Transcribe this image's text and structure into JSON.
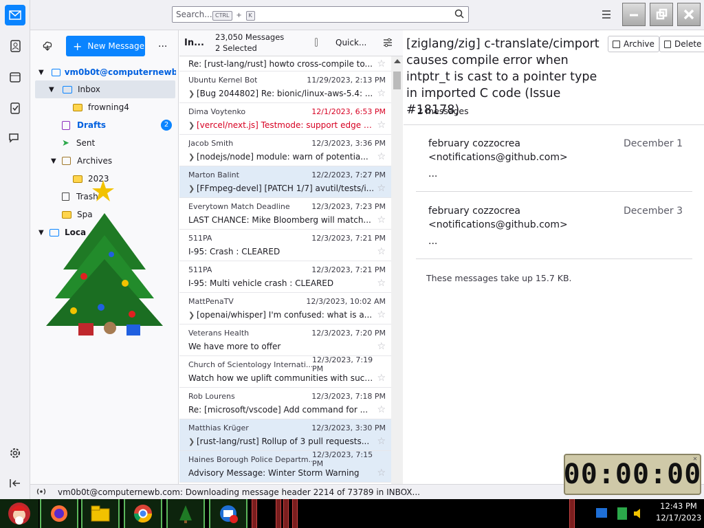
{
  "search": {
    "placeholder": "Search...",
    "shortcut_key1": "CTRL",
    "shortcut_plus": "+",
    "shortcut_key2": "K"
  },
  "folders": {
    "new_message": "New Message",
    "more": "...",
    "account": "vm0b0t@computernewb...",
    "items": [
      {
        "label": "Inbox",
        "icon": "inbox-icon"
      },
      {
        "label": "frowning4",
        "icon": "folder-icon"
      },
      {
        "label": "Drafts",
        "icon": "drafts-icon",
        "badge": "2"
      },
      {
        "label": "Sent",
        "icon": "sent-icon"
      },
      {
        "label": "Archives",
        "icon": "archive-icon"
      },
      {
        "label": "2023",
        "icon": "folder-icon"
      },
      {
        "label": "Trash",
        "icon": "trash-icon"
      },
      {
        "label": "Spa",
        "icon": "folder-icon"
      },
      {
        "label": "Loca",
        "icon": "local-folder-icon"
      }
    ]
  },
  "list": {
    "folder_label": "In...",
    "count": "23,050 Messages",
    "selected": "2 Selected",
    "quick_filter": "Quick...",
    "rows": [
      {
        "sender": "",
        "date": "",
        "subject": "Re: [rust-lang/rust] howto cross-compile to...",
        "thread": false,
        "selected": false,
        "red": false
      },
      {
        "sender": "Ubuntu Kernel Bot",
        "date": "11/29/2023, 2:13 PM",
        "subject": "[Bug 2044802] Re: bionic/linux-aws-5.4: ...",
        "thread": true,
        "selected": false,
        "red": false
      },
      {
        "sender": "Dima Voytenko",
        "date": "12/1/2023, 6:53 PM",
        "subject": "[vercel/next.js] Testmode: support edge fu...",
        "thread": true,
        "selected": false,
        "red": true
      },
      {
        "sender": "Jacob Smith",
        "date": "12/3/2023, 3:36 PM",
        "subject": "[nodejs/node] module: warn of potentia...",
        "thread": true,
        "selected": false,
        "red": false
      },
      {
        "sender": "Marton Balint",
        "date": "12/2/2023, 7:27 PM",
        "subject": "[FFmpeg-devel] [PATCH 1/7] avutil/tests/i...",
        "thread": true,
        "selected": true,
        "red": false
      },
      {
        "sender": "Everytown Match Deadline",
        "date": "12/3/2023, 7:23 PM",
        "subject": "LAST CHANCE: Mike Bloomberg will match...",
        "thread": false,
        "selected": false,
        "red": false
      },
      {
        "sender": "511PA",
        "date": "12/3/2023, 7:21 PM",
        "subject": "I-95: Crash : CLEARED",
        "thread": false,
        "selected": false,
        "red": false
      },
      {
        "sender": "511PA",
        "date": "12/3/2023, 7:21 PM",
        "subject": "I-95: Multi vehicle crash : CLEARED",
        "thread": false,
        "selected": false,
        "red": false
      },
      {
        "sender": "MattPenaTV",
        "date": "12/3/2023, 10:02 AM",
        "subject": "[openai/whisper] I'm confused: what is a...",
        "thread": true,
        "selected": false,
        "red": false
      },
      {
        "sender": "Veterans Health",
        "date": "12/3/2023, 7:20 PM",
        "subject": "We have more to offer",
        "thread": false,
        "selected": false,
        "red": false
      },
      {
        "sender": "Church of Scientology Internati...",
        "date": "12/3/2023, 7:19 PM",
        "subject": "Watch how we uplift communities with succ...",
        "thread": false,
        "selected": false,
        "red": false
      },
      {
        "sender": "Rob Lourens",
        "date": "12/3/2023, 7:18 PM",
        "subject": "Re: [microsoft/vscode] Add command for ...",
        "thread": false,
        "selected": false,
        "red": false
      },
      {
        "sender": "Matthias Krüger",
        "date": "12/3/2023, 3:30 PM",
        "subject": "[rust-lang/rust] Rollup of 3 pull requests...",
        "thread": true,
        "selected": true,
        "red": false
      },
      {
        "sender": "Haines Borough Police Departm...",
        "date": "12/3/2023, 7:15 PM",
        "subject": "Advisory Message: Winter Storm Warning",
        "thread": false,
        "selected": true,
        "red": false
      }
    ]
  },
  "reader": {
    "archive": "Archive",
    "delete": "Delete",
    "title": "[ziglang/zig] c-translate/cimport causes compile error when intptr_t is cast to a pointer type in imported C code (Issue #18178)",
    "count": "2 messages",
    "messages": [
      {
        "from": "february cozzocrea",
        "email": "<notifications@github.com>",
        "date": "December 1",
        "preview": "..."
      },
      {
        "from": "february cozzocrea",
        "email": "<notifications@github.com>",
        "date": "December 3",
        "preview": "..."
      }
    ],
    "size_note": "These messages take up 15.7 KB."
  },
  "status": {
    "text": "vm0b0t@computernewb.com: Downloading message header 2214 of 73789 in INBOX..."
  },
  "timer": {
    "display": "00:00:00"
  },
  "clock": {
    "time": "12:43 PM",
    "date": "12/17/2023"
  },
  "colors": {
    "accent": "#0a84ff",
    "selected_row": "#e0ebf7",
    "red_subject": "#d70022"
  }
}
